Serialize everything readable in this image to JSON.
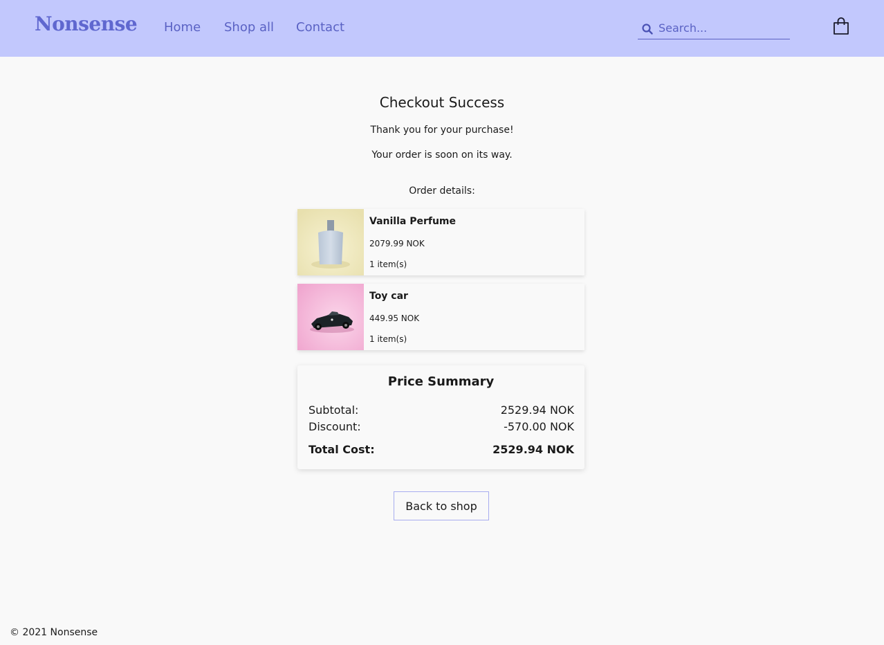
{
  "header": {
    "logo": "Nonsense",
    "nav": [
      "Home",
      "Shop all",
      "Contact"
    ],
    "search_placeholder": "Search...",
    "icons": [
      "search-icon",
      "shopping-bag-icon"
    ],
    "background_color": "#c2c8fd",
    "accent_color": "#5a62c4"
  },
  "main": {
    "title": "Checkout Success",
    "thank_you": "Thank you for your purchase!",
    "order_soon": "Your order is soon on its way.",
    "order_details_label": "Order details:",
    "items": [
      {
        "name": "Vanilla Perfume",
        "price": "2079.99 NOK",
        "quantity": "1 item(s)",
        "image": "perfume-bottle-image"
      },
      {
        "name": "Toy car",
        "price": "449.95 NOK",
        "quantity": "1 item(s)",
        "image": "toy-car-image"
      }
    ]
  },
  "summary": {
    "title": "Price Summary",
    "subtotal_label": "Subtotal:",
    "subtotal_value": "2529.94 NOK",
    "discount_label": "Discount:",
    "discount_value": "-570.00 NOK",
    "total_label": "Total Cost:",
    "total_value": "2529.94 NOK"
  },
  "actions": {
    "back_label": "Back to shop"
  },
  "footer": {
    "copyright": "© 2021 Nonsense"
  }
}
